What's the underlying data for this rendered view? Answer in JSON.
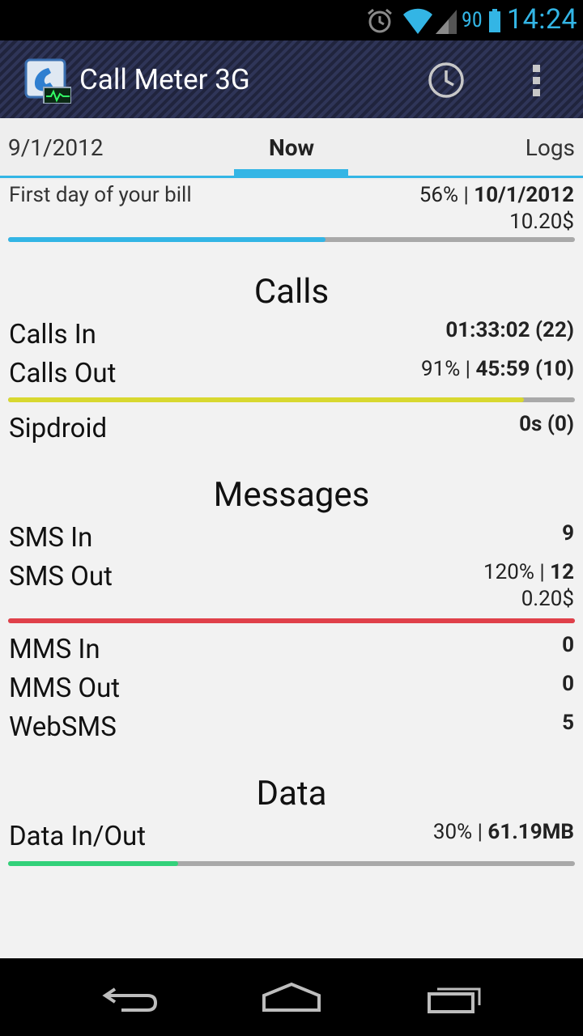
{
  "status_bar": {
    "battery_percent": "90",
    "time": "14:24"
  },
  "action_bar": {
    "title": "Call Meter 3G",
    "icons": [
      "app-icon",
      "history-icon",
      "overflow-menu-icon"
    ]
  },
  "tabs": {
    "prev": "9/1/2012",
    "current": "Now",
    "next": "Logs"
  },
  "billing": {
    "label": "First day of your bill",
    "percent": "56% | ",
    "date": "10/1/2012",
    "cost": "10.20$",
    "progress": 0.56,
    "color": "#33b5e5"
  },
  "calls": {
    "title": "Calls",
    "calls_in_label": "Calls In",
    "calls_in_value": "01:33:02 (22)",
    "calls_out_label": "Calls Out",
    "calls_out_percent": "91% | ",
    "calls_out_value": "45:59 (10)",
    "progress": 0.91,
    "color": "#d8d830",
    "sipdroid_label": "Sipdroid",
    "sipdroid_value": "0s (0)"
  },
  "messages": {
    "title": "Messages",
    "sms_in_label": "SMS In",
    "sms_in_value": "9",
    "sms_out_label": "SMS Out",
    "sms_out_percent": "120% | ",
    "sms_out_value": "12",
    "sms_out_cost": "0.20$",
    "progress": 1.0,
    "color": "#e0404a",
    "mms_in_label": "MMS In",
    "mms_in_value": "0",
    "mms_out_label": "MMS Out",
    "mms_out_value": "0",
    "websms_label": "WebSMS",
    "websms_value": "5"
  },
  "data": {
    "title": "Data",
    "data_label": "Data In/Out",
    "data_percent": "30% | ",
    "data_value": "61.19MB",
    "progress": 0.3,
    "color": "#33d17a"
  },
  "nav_bar": {
    "icons": [
      "back-icon",
      "home-icon",
      "recent-apps-icon"
    ]
  }
}
